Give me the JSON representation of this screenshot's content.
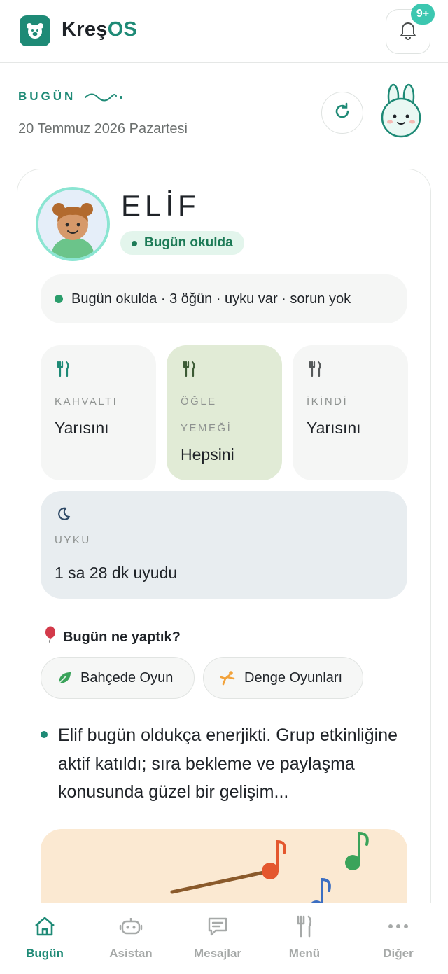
{
  "app": {
    "brand_prefix": "Kreş",
    "brand_suffix": "OS",
    "notification_badge": "9+"
  },
  "date_section": {
    "label": "BUGÜN",
    "date": "20 Temmuz 2026 Pazartesi"
  },
  "child": {
    "name": "ELİF",
    "status": "Bugün okulda",
    "summary": "Bugün okulda · 3 öğün · uyku var · sorun yok"
  },
  "meals": [
    {
      "label": "KAHVALTI",
      "value": "Yarısını",
      "icon": "fork-knife-icon"
    },
    {
      "label_line1": "ÖĞLE",
      "label_line2": "YEMEĞİ",
      "value": "Hepsini",
      "icon": "fork-knife-icon"
    },
    {
      "label": "İKİNDİ",
      "value": "Yarısını",
      "icon": "fork-knife-icon"
    }
  ],
  "sleep": {
    "label": "UYKU",
    "value": "1 sa 28 dk uyudu",
    "icon": "moon-icon"
  },
  "activities": {
    "title": "Bugün ne yaptık?",
    "items": [
      {
        "label": "Bahçede Oyun",
        "icon": "leaf-icon"
      },
      {
        "label": "Denge Oyunları",
        "icon": "gymnast-icon"
      }
    ]
  },
  "teacher_note": "Elif bugün oldukça enerjikti. Grup etkinliğine aktif katıldı; sıra bekleme ve paylaşma konusunda güzel bir gelişim...",
  "bottom_nav": [
    {
      "label": "Bugün",
      "icon": "home-icon",
      "active": true
    },
    {
      "label": "Asistan",
      "icon": "robot-icon",
      "active": false
    },
    {
      "label": "Mesajlar",
      "icon": "message-icon",
      "active": false
    },
    {
      "label": "Menü",
      "icon": "fork-knife-icon",
      "active": false
    },
    {
      "label": "Diğer",
      "icon": "more-icon",
      "active": false
    }
  ],
  "colors": {
    "accent": "#1e8a76",
    "badge": "#3cc7b0",
    "status_bg": "#e3f5ec",
    "lunch_card_bg": "#e1ebd6",
    "sleep_card_bg": "#e8edf0"
  }
}
